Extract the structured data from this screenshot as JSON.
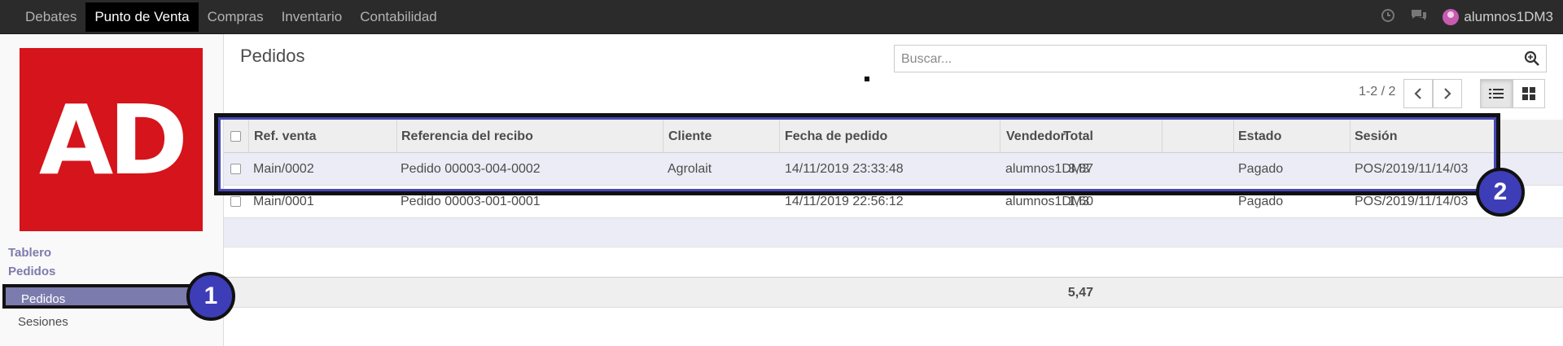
{
  "topnav": {
    "menus": [
      "Debates",
      "Punto de Venta",
      "Compras",
      "Inventario",
      "Contabilidad"
    ],
    "active": "Punto de Venta",
    "user": "alumnos1DM3"
  },
  "sidebar": {
    "logo_text": "AD",
    "sections": [
      "Tablero",
      "Pedidos"
    ],
    "items": [
      "Pedidos",
      "Sesiones"
    ]
  },
  "control_panel": {
    "title": "Pedidos",
    "search_placeholder": "Buscar...",
    "pager": "1-2 / 2"
  },
  "table": {
    "columns": [
      "Ref. venta",
      "Referencia del recibo",
      "Cliente",
      "Fecha de pedido",
      "Vendedor",
      "Total",
      "Estado",
      "Sesión"
    ],
    "rows": [
      [
        "Main/0002",
        "Pedido 00003-004-0002",
        "Agrolait",
        "14/11/2019 23:33:48",
        "alumnos1DM3",
        "3,87",
        "Pagado",
        "POS/2019/11/14/03"
      ],
      [
        "Main/0001",
        "Pedido 00003-001-0001",
        "",
        "14/11/2019 22:56:12",
        "alumnos1DM3",
        "1,60",
        "Pagado",
        "POS/2019/11/14/03"
      ]
    ],
    "footer_total": "5,47"
  },
  "annotations": [
    "1",
    "2"
  ],
  "colors": {
    "navbar": "#2b2b2b",
    "accent": "#7c7bad",
    "logo_red": "#d5141b",
    "badge": "#3d3db8"
  }
}
